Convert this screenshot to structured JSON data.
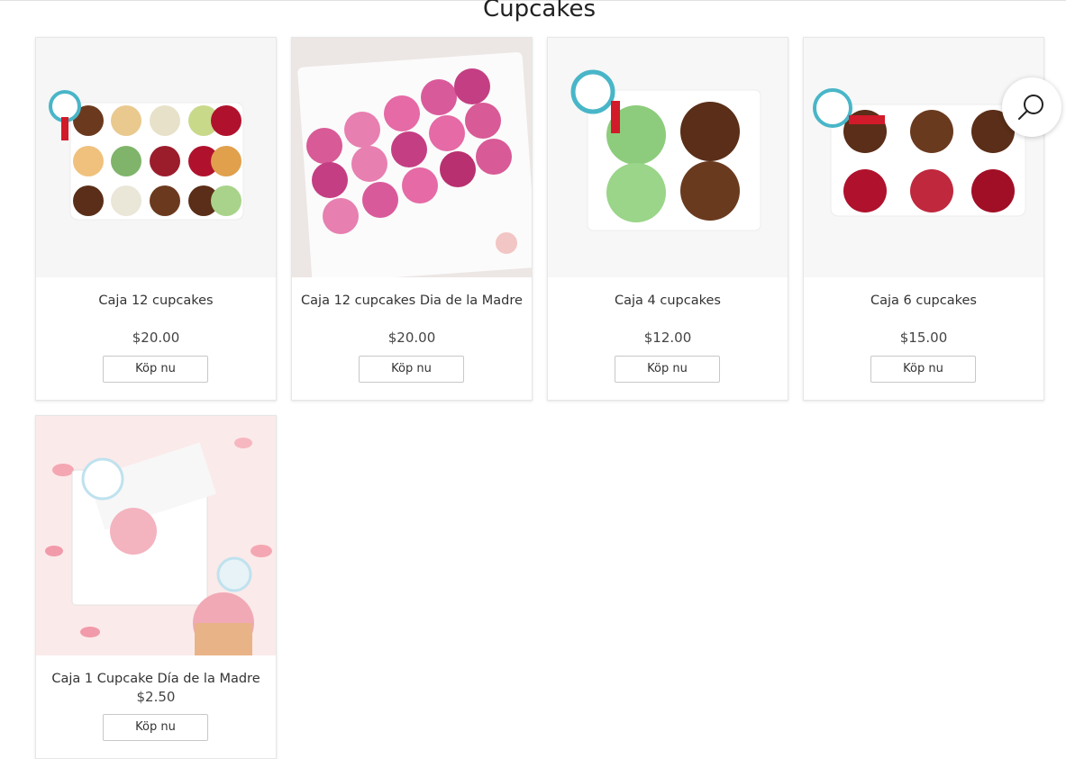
{
  "page": {
    "title": "Cupcakes"
  },
  "products": [
    {
      "name": "Caja 12 cupcakes",
      "price": "$20.00",
      "button": "Köp nu"
    },
    {
      "name": "Caja 12 cupcakes Dia de la Madre",
      "price": "$20.00",
      "button": "Köp nu"
    },
    {
      "name": "Caja 4 cupcakes",
      "price": "$12.00",
      "button": "Köp nu"
    },
    {
      "name": "Caja 6 cupcakes",
      "price": "$15.00",
      "button": "Köp nu"
    },
    {
      "name": "Caja 1 Cupcake Día de la Madre",
      "price": "$2.50",
      "button": "Köp nu"
    }
  ],
  "icons": {
    "search": "search-icon"
  },
  "colors": {
    "card_border": "#e6e6e6",
    "button_border": "#c8c8c8",
    "bg": "#ffffff"
  }
}
